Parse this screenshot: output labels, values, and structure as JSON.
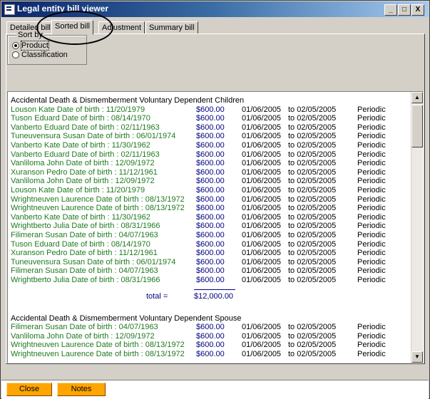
{
  "window": {
    "title": "Legal entity bill viewer",
    "controls": [
      "_",
      "□",
      "X"
    ]
  },
  "tabs": [
    {
      "label": "Detailed bill",
      "active": false
    },
    {
      "label": "Sorted bill",
      "active": true
    },
    {
      "label": "Adjustment",
      "active": false
    },
    {
      "label": "Summary bill",
      "active": false
    }
  ],
  "sort_by": {
    "legend": "Sort by",
    "options": [
      {
        "label": "Product",
        "selected": true
      },
      {
        "label": "Classification",
        "selected": false
      }
    ]
  },
  "sections": [
    {
      "header": "Accidental Death & Dismemberment Voluntary Dependent Children",
      "rows": [
        {
          "name": "Louson  Kate  Date of birth : 11/20/1979",
          "amount": "$600.00",
          "from": "01/06/2005",
          "to": "to 02/05/2005",
          "type": "Periodic"
        },
        {
          "name": "Tuson  Eduard  Date of birth : 08/14/1970",
          "amount": "$600.00",
          "from": "01/06/2005",
          "to": "to 02/05/2005",
          "type": "Periodic"
        },
        {
          "name": "Vanberto  Eduard  Date of birth : 02/11/1963",
          "amount": "$600.00",
          "from": "01/06/2005",
          "to": "to 02/05/2005",
          "type": "Periodic"
        },
        {
          "name": "Tuneuvensura  Susan  Date of birth : 06/01/1974",
          "amount": "$600.00",
          "from": "01/06/2005",
          "to": "to 02/05/2005",
          "type": "Periodic"
        },
        {
          "name": "Vanberto  Kate  Date of birth : 11/30/1962",
          "amount": "$600.00",
          "from": "01/06/2005",
          "to": "to 02/05/2005",
          "type": "Periodic"
        },
        {
          "name": "Vanberto  Eduard  Date of birth : 02/11/1963",
          "amount": "$600.00",
          "from": "01/06/2005",
          "to": "to 02/05/2005",
          "type": "Periodic"
        },
        {
          "name": "Vanliloma  John  Date of birth : 12/09/1972",
          "amount": "$600.00",
          "from": "01/06/2005",
          "to": "to 02/05/2005",
          "type": "Periodic"
        },
        {
          "name": "Xuranson  Pedro  Date of birth : 11/12/1961",
          "amount": "$600.00",
          "from": "01/06/2005",
          "to": "to 02/05/2005",
          "type": "Periodic"
        },
        {
          "name": "Vanliloma  John  Date of birth : 12/09/1972",
          "amount": "$600.00",
          "from": "01/06/2005",
          "to": "to 02/05/2005",
          "type": "Periodic"
        },
        {
          "name": "Louson  Kate  Date of birth : 11/20/1979",
          "amount": "$600.00",
          "from": "01/06/2005",
          "to": "to 02/05/2005",
          "type": "Periodic"
        },
        {
          "name": "Wrightneuven  Laurence  Date of birth : 08/13/1972",
          "amount": "$600.00",
          "from": "01/06/2005",
          "to": "to 02/05/2005",
          "type": "Periodic"
        },
        {
          "name": "Wrightneuven  Laurence  Date of birth : 08/13/1972",
          "amount": "$600.00",
          "from": "01/06/2005",
          "to": "to 02/05/2005",
          "type": "Periodic"
        },
        {
          "name": "Vanberto  Kate  Date of birth : 11/30/1962",
          "amount": "$600.00",
          "from": "01/06/2005",
          "to": "to 02/05/2005",
          "type": "Periodic"
        },
        {
          "name": "Wrightberto  Julia  Date of birth : 08/31/1966",
          "amount": "$600.00",
          "from": "01/06/2005",
          "to": "to 02/05/2005",
          "type": "Periodic"
        },
        {
          "name": "Filimeran  Susan  Date of birth : 04/07/1963",
          "amount": "$600.00",
          "from": "01/06/2005",
          "to": "to 02/05/2005",
          "type": "Periodic"
        },
        {
          "name": "Tuson  Eduard  Date of birth : 08/14/1970",
          "amount": "$600.00",
          "from": "01/06/2005",
          "to": "to 02/05/2005",
          "type": "Periodic"
        },
        {
          "name": "Xuranson  Pedro  Date of birth : 11/12/1961",
          "amount": "$600.00",
          "from": "01/06/2005",
          "to": "to 02/05/2005",
          "type": "Periodic"
        },
        {
          "name": "Tuneuvensura  Susan  Date of birth : 06/01/1974",
          "amount": "$600.00",
          "from": "01/06/2005",
          "to": "to 02/05/2005",
          "type": "Periodic"
        },
        {
          "name": "Filimeran  Susan  Date of birth : 04/07/1963",
          "amount": "$600.00",
          "from": "01/06/2005",
          "to": "to 02/05/2005",
          "type": "Periodic"
        },
        {
          "name": "Wrightberto  Julia  Date of birth : 08/31/1966",
          "amount": "$600.00",
          "from": "01/06/2005",
          "to": "to 02/05/2005",
          "type": "Periodic"
        }
      ],
      "total_label": "total =",
      "total": "$12,000.00"
    },
    {
      "header": "Accidental Death & Dismemberment Voluntary Dependent Spouse",
      "rows": [
        {
          "name": "Filimeran  Susan  Date of birth : 04/07/1963",
          "amount": "$600.00",
          "from": "01/06/2005",
          "to": "to 02/05/2005",
          "type": "Periodic"
        },
        {
          "name": "Vanliloma  John  Date of birth : 12/09/1972",
          "amount": "$600.00",
          "from": "01/06/2005",
          "to": "to 02/05/2005",
          "type": "Periodic"
        },
        {
          "name": "Wrightneuven  Laurence  Date of birth : 08/13/1972",
          "amount": "$600.00",
          "from": "01/06/2005",
          "to": "to 02/05/2005",
          "type": "Periodic"
        },
        {
          "name": "Wrightneuven  Laurence  Date of birth : 08/13/1972",
          "amount": "$600.00",
          "from": "01/06/2005",
          "to": "to 02/05/2005",
          "type": "Periodic"
        }
      ]
    }
  ],
  "buttons": {
    "close": "Close",
    "notes": "Notes"
  }
}
